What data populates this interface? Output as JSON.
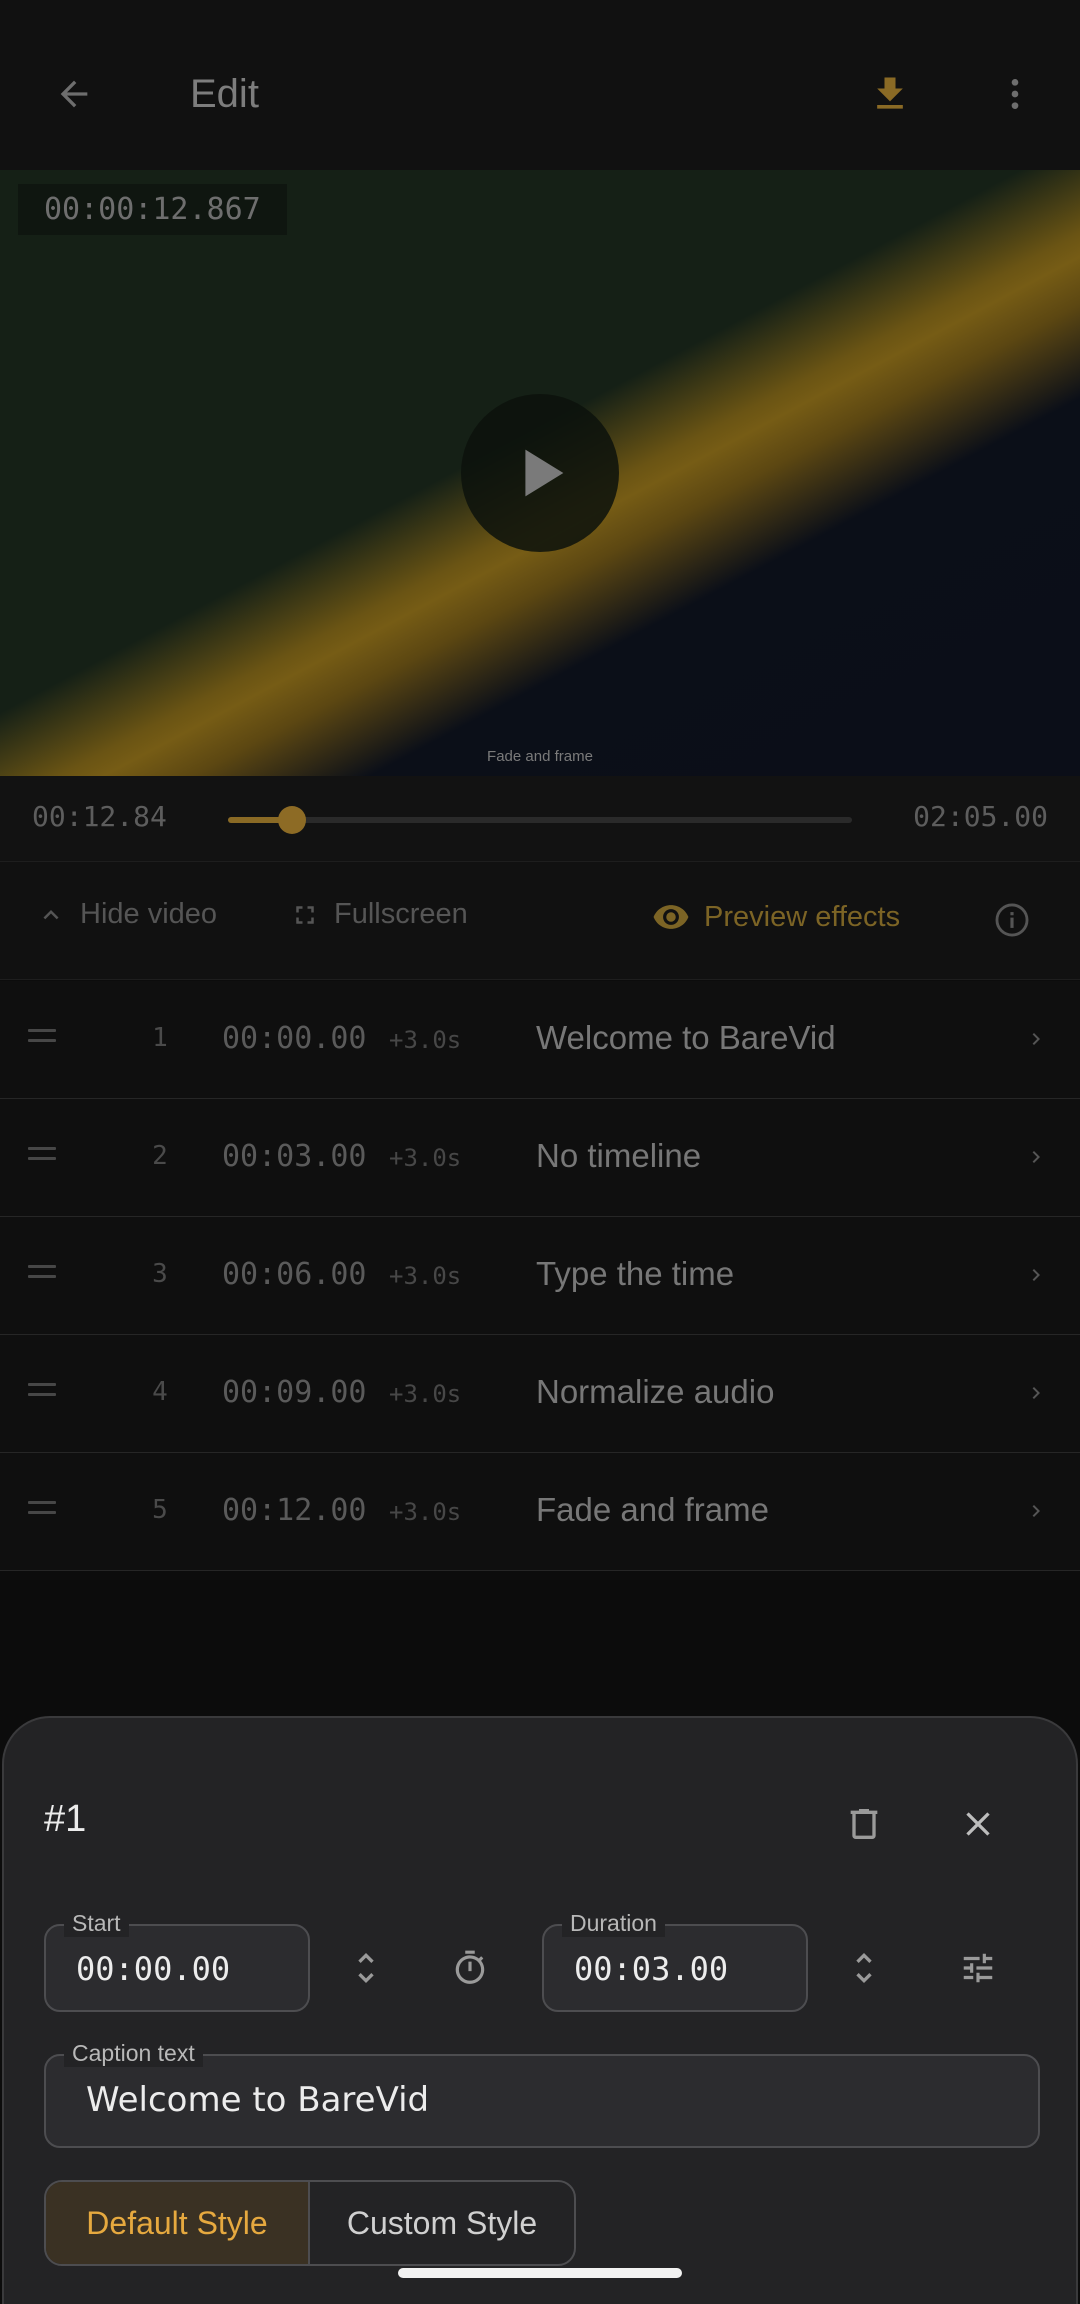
{
  "appbar": {
    "title": "Edit",
    "back_icon": "arrow-back-icon",
    "download_icon": "download-icon",
    "more_icon": "more-vert-icon"
  },
  "video": {
    "timecode": "00:00:12.867",
    "caption_overlay": "Fade and frame"
  },
  "scrubber": {
    "current": "00:12.84",
    "total": "02:05.00",
    "progress": 0.1027
  },
  "controls": {
    "hide_video": "Hide video",
    "fullscreen": "Fullscreen",
    "preview_effects": "Preview effects"
  },
  "captions": [
    {
      "num": "1",
      "time": "00:00.00",
      "dur": "+3.0s",
      "text": "Welcome to BareVid"
    },
    {
      "num": "2",
      "time": "00:03.00",
      "dur": "+3.0s",
      "text": "No timeline"
    },
    {
      "num": "3",
      "time": "00:06.00",
      "dur": "+3.0s",
      "text": "Type the time"
    },
    {
      "num": "4",
      "time": "00:09.00",
      "dur": "+3.0s",
      "text": "Normalize audio"
    },
    {
      "num": "5",
      "time": "00:12.00",
      "dur": "+3.0s",
      "text": "Fade and frame"
    }
  ],
  "sheet": {
    "title": "#1",
    "start_label": "Start",
    "start_value": "00:00.00",
    "duration_label": "Duration",
    "duration_value": "00:03.00",
    "caption_label": "Caption text",
    "caption_value": "Welcome to BareVid",
    "default_style": "Default Style",
    "custom_style": "Custom Style"
  },
  "colors": {
    "accent": "#e6a93f",
    "accent_dim": "#8a6a25",
    "background": "#0c0c0c",
    "sheet": "#232325"
  }
}
